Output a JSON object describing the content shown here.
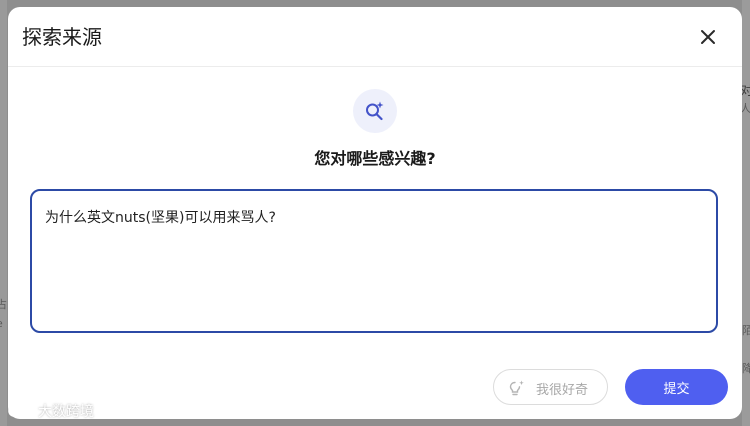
{
  "background": {
    "right_text_1": "对",
    "right_text_2": "人",
    "right_text_3": "陌",
    "right_text_4": "降",
    "left_text_1": "占",
    "left_text_2": "e"
  },
  "modal": {
    "title": "探索来源",
    "close_icon": "close-icon",
    "hero_icon": "sparkle-search-icon",
    "question": "您对哪些感兴趣?",
    "input_value": "为什么英文nuts(坚果)可以用来骂人?",
    "curious_button": {
      "label": "我很好奇",
      "icon": "lightbulb-sparkle-icon"
    },
    "submit_label": "提交"
  },
  "watermark": {
    "text": "大数跨境"
  },
  "colors": {
    "accent": "#4f5ff0",
    "input_border": "#2c4aa6",
    "icon_bg": "#eef0fb"
  }
}
